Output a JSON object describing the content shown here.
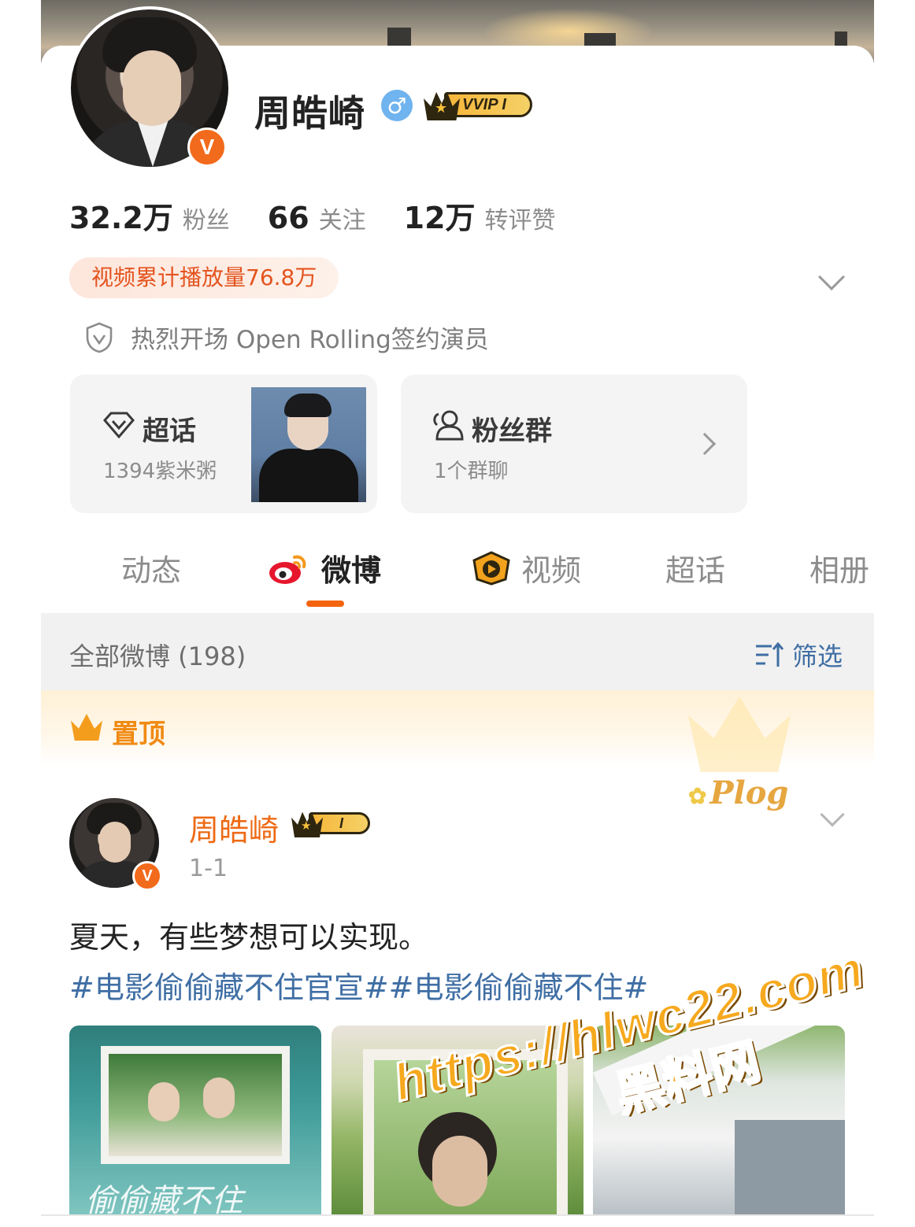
{
  "profile": {
    "name": "周皓崎",
    "gender_icon": "male-icon",
    "vvip_badge": "VVIP I",
    "verified_mark": "V"
  },
  "stats": [
    {
      "value": "32.2万",
      "label": "粉丝"
    },
    {
      "value": "66",
      "label": "关注"
    },
    {
      "value": "12万",
      "label": "转评赞"
    }
  ],
  "video_play_pill": "视频累计播放量76.8万",
  "sign_info": "热烈开场 Open Rolling签约演员",
  "super_topic": {
    "title": "超话",
    "subtitle": "1394紫米粥"
  },
  "fan_group": {
    "title": "粉丝群",
    "subtitle": "1个群聊"
  },
  "tabs": [
    {
      "label": "动态",
      "active": false
    },
    {
      "label": "微博",
      "active": true
    },
    {
      "label": "视频",
      "active": false
    },
    {
      "label": "超话",
      "active": false
    },
    {
      "label": "相册",
      "active": false
    }
  ],
  "feed_header": {
    "count_label": "全部微博 (198)",
    "filter_label": "筛选"
  },
  "pinned_label": "置顶",
  "post": {
    "author": "周皓崎",
    "vip_level": "I",
    "date": "1-1",
    "text": "夏天，有些梦想可以实现。",
    "tags": "#电影偷偷藏不住官宣##电影偷偷藏不住#",
    "decoration": "Plog",
    "thumbnail_caption": "偷偷藏不住"
  },
  "watermark": {
    "url": "https://hlwc22.com",
    "name": "黑料网"
  },
  "colors": {
    "accent": "#f4640e",
    "link": "#3f6ea4",
    "pill_text": "#e4541f",
    "author": "#ee6a14"
  }
}
